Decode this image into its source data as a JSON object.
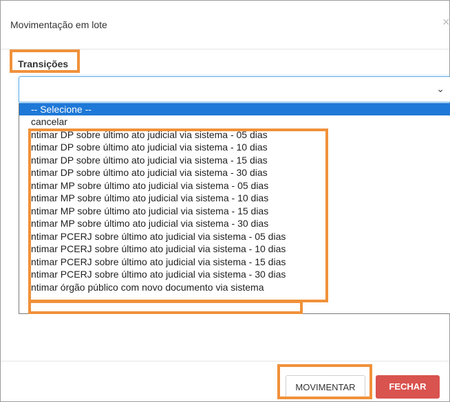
{
  "modal": {
    "title": "Movimentação em lote",
    "close_glyph": "×"
  },
  "form": {
    "label": "Transições",
    "select_value": "",
    "chevron_glyph": "⌄"
  },
  "dropdown": {
    "options": [
      "-- Selecione --",
      "cancelar",
      "ntimar DP sobre último ato judicial via sistema - 05 dias",
      "ntimar DP sobre último ato judicial via sistema - 10 dias",
      "ntimar DP sobre último ato judicial via sistema - 15 dias",
      "ntimar DP sobre último ato judicial via sistema - 30 dias",
      "ntimar MP sobre último ato judicial via sistema - 05 dias",
      "ntimar MP sobre último ato judicial via sistema - 10 dias",
      "ntimar MP sobre último ato judicial via sistema - 15 dias",
      "ntimar MP sobre último ato judicial via sistema - 30 dias",
      "ntimar PCERJ sobre último ato judicial via sistema - 05 dias",
      "ntimar PCERJ sobre último ato judicial via sistema - 10 dias",
      "ntimar PCERJ sobre último ato judicial via sistema - 15 dias",
      "ntimar PCERJ sobre último ato judicial via sistema - 30 dias",
      "ntimar órgão público com novo documento via sistema"
    ],
    "selected_index": 0
  },
  "footer": {
    "movimentar_label": "MOVIMENTAR",
    "fechar_label": "FECHAR"
  },
  "colors": {
    "highlight": "#f0913a",
    "selected_option": "#1e78d7",
    "danger_button": "#d9534f"
  }
}
